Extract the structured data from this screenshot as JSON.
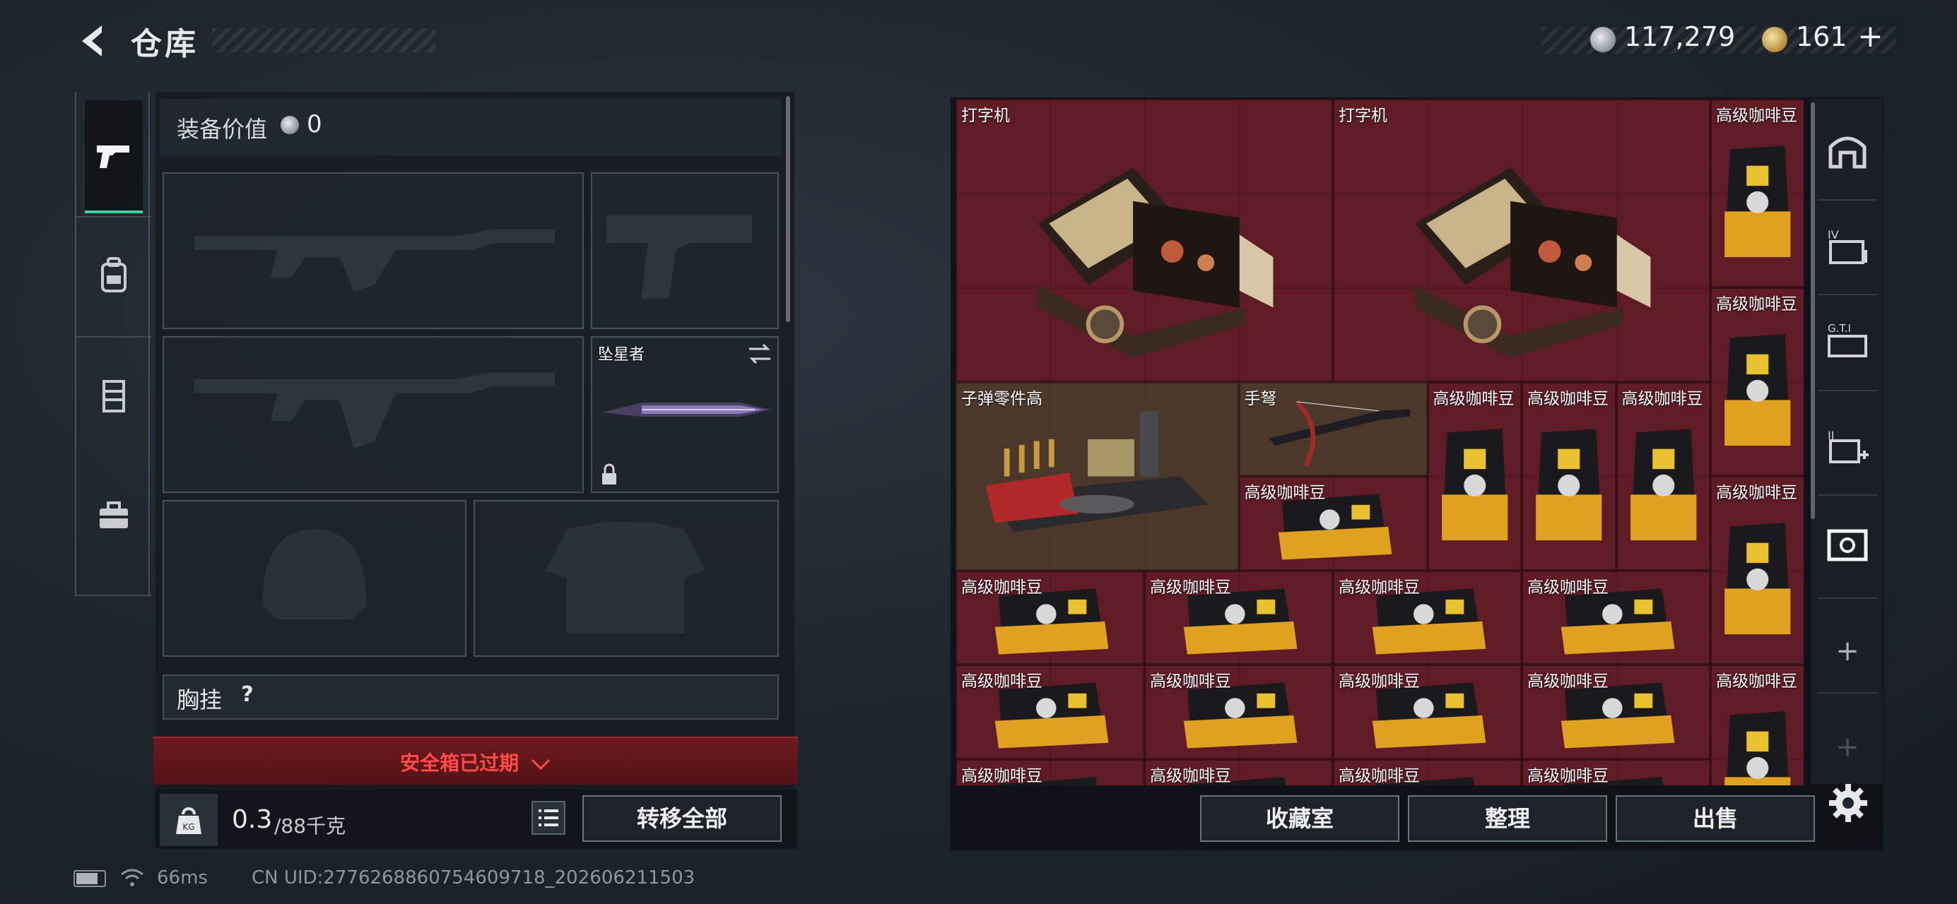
{
  "header": {
    "title": "仓库",
    "currency_silver": "117,279",
    "currency_gold": "161",
    "add_label": "+"
  },
  "equipment": {
    "value_label": "装备价值",
    "value": "0",
    "melee_label": "坠星者",
    "chest_rig_label": "胸挂",
    "chest_rig_help": "?",
    "safe_box_text": "安全箱已过期",
    "weight_current": "0.3",
    "weight_max": "/88千克",
    "kg_label": "KG",
    "transfer_all": "转移全部"
  },
  "stash": {
    "items": [
      {
        "label": "打字机"
      },
      {
        "label": "打字机"
      },
      {
        "label": "高级咖啡豆"
      },
      {
        "label": "高级咖啡豆"
      },
      {
        "label": "子弹零件高"
      },
      {
        "label": "手弩"
      },
      {
        "label": "高级咖啡豆"
      },
      {
        "label": "高级咖啡豆"
      },
      {
        "label": "高级咖啡豆"
      },
      {
        "label": "高级咖啡豆"
      },
      {
        "label": "高级咖啡豆"
      },
      {
        "label": "高级咖啡豆"
      },
      {
        "label": "高级咖啡豆"
      },
      {
        "label": "高级咖啡豆"
      },
      {
        "label": "高级咖啡豆"
      },
      {
        "label": "高级咖啡豆"
      },
      {
        "label": "高级咖啡豆"
      },
      {
        "label": "高级咖啡豆"
      },
      {
        "label": "高级咖啡豆"
      },
      {
        "label": "高级咖啡豆"
      },
      {
        "label": "高级咖啡豆"
      },
      {
        "label": "高级咖啡豆"
      },
      {
        "label": "高级咖啡豆"
      },
      {
        "label": "高级咖啡豆"
      }
    ],
    "buttons": {
      "collection": "收藏室",
      "organize": "整理",
      "sell": "出售"
    },
    "side_add": "+"
  },
  "status": {
    "ping": "66ms",
    "uid": "CN UID:2776268860754609718_202606211503"
  },
  "colors": {
    "grid_bg": "#5a1a24",
    "accent_green": "#3ed29a",
    "warning_red": "#ff4a4a"
  },
  "icons": {
    "back": "back-arrow-icon",
    "rail": [
      "pistol-icon",
      "backpack-icon",
      "vest-icon",
      "toolbox-icon"
    ],
    "right_rail": [
      "storage-room-icon",
      "stash-4-icon",
      "gti-icon",
      "stash-add-icon",
      "photo-icon",
      "plus-icon",
      "plus-icon",
      "gear-icon"
    ]
  }
}
